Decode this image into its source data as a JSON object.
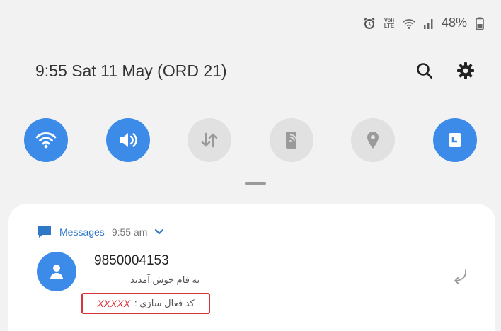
{
  "statusbar": {
    "volte_top": "Vol)",
    "volte_bottom": "LTE",
    "battery": "48%"
  },
  "header": {
    "title": "9:55  Sat 11 May (ORD 21)"
  },
  "quick_settings": [
    {
      "icon": "wifi-icon",
      "state": "on"
    },
    {
      "icon": "sound-icon",
      "state": "on"
    },
    {
      "icon": "mobile-data-icon",
      "state": "off"
    },
    {
      "icon": "screen-cast-icon",
      "state": "off"
    },
    {
      "icon": "location-icon",
      "state": "off"
    },
    {
      "icon": "secure-folder-icon",
      "state": "on"
    }
  ],
  "notification": {
    "app_name": "Messages",
    "time": "9:55 am",
    "sender": "9850004153",
    "line1": "به فام خوش آمدید",
    "code_label": "کد فعال سازی :",
    "code_value": "XXXXX"
  },
  "colors": {
    "accent": "#3d8be8",
    "highlight": "#d8343c",
    "app_name": "#2f78c8"
  }
}
